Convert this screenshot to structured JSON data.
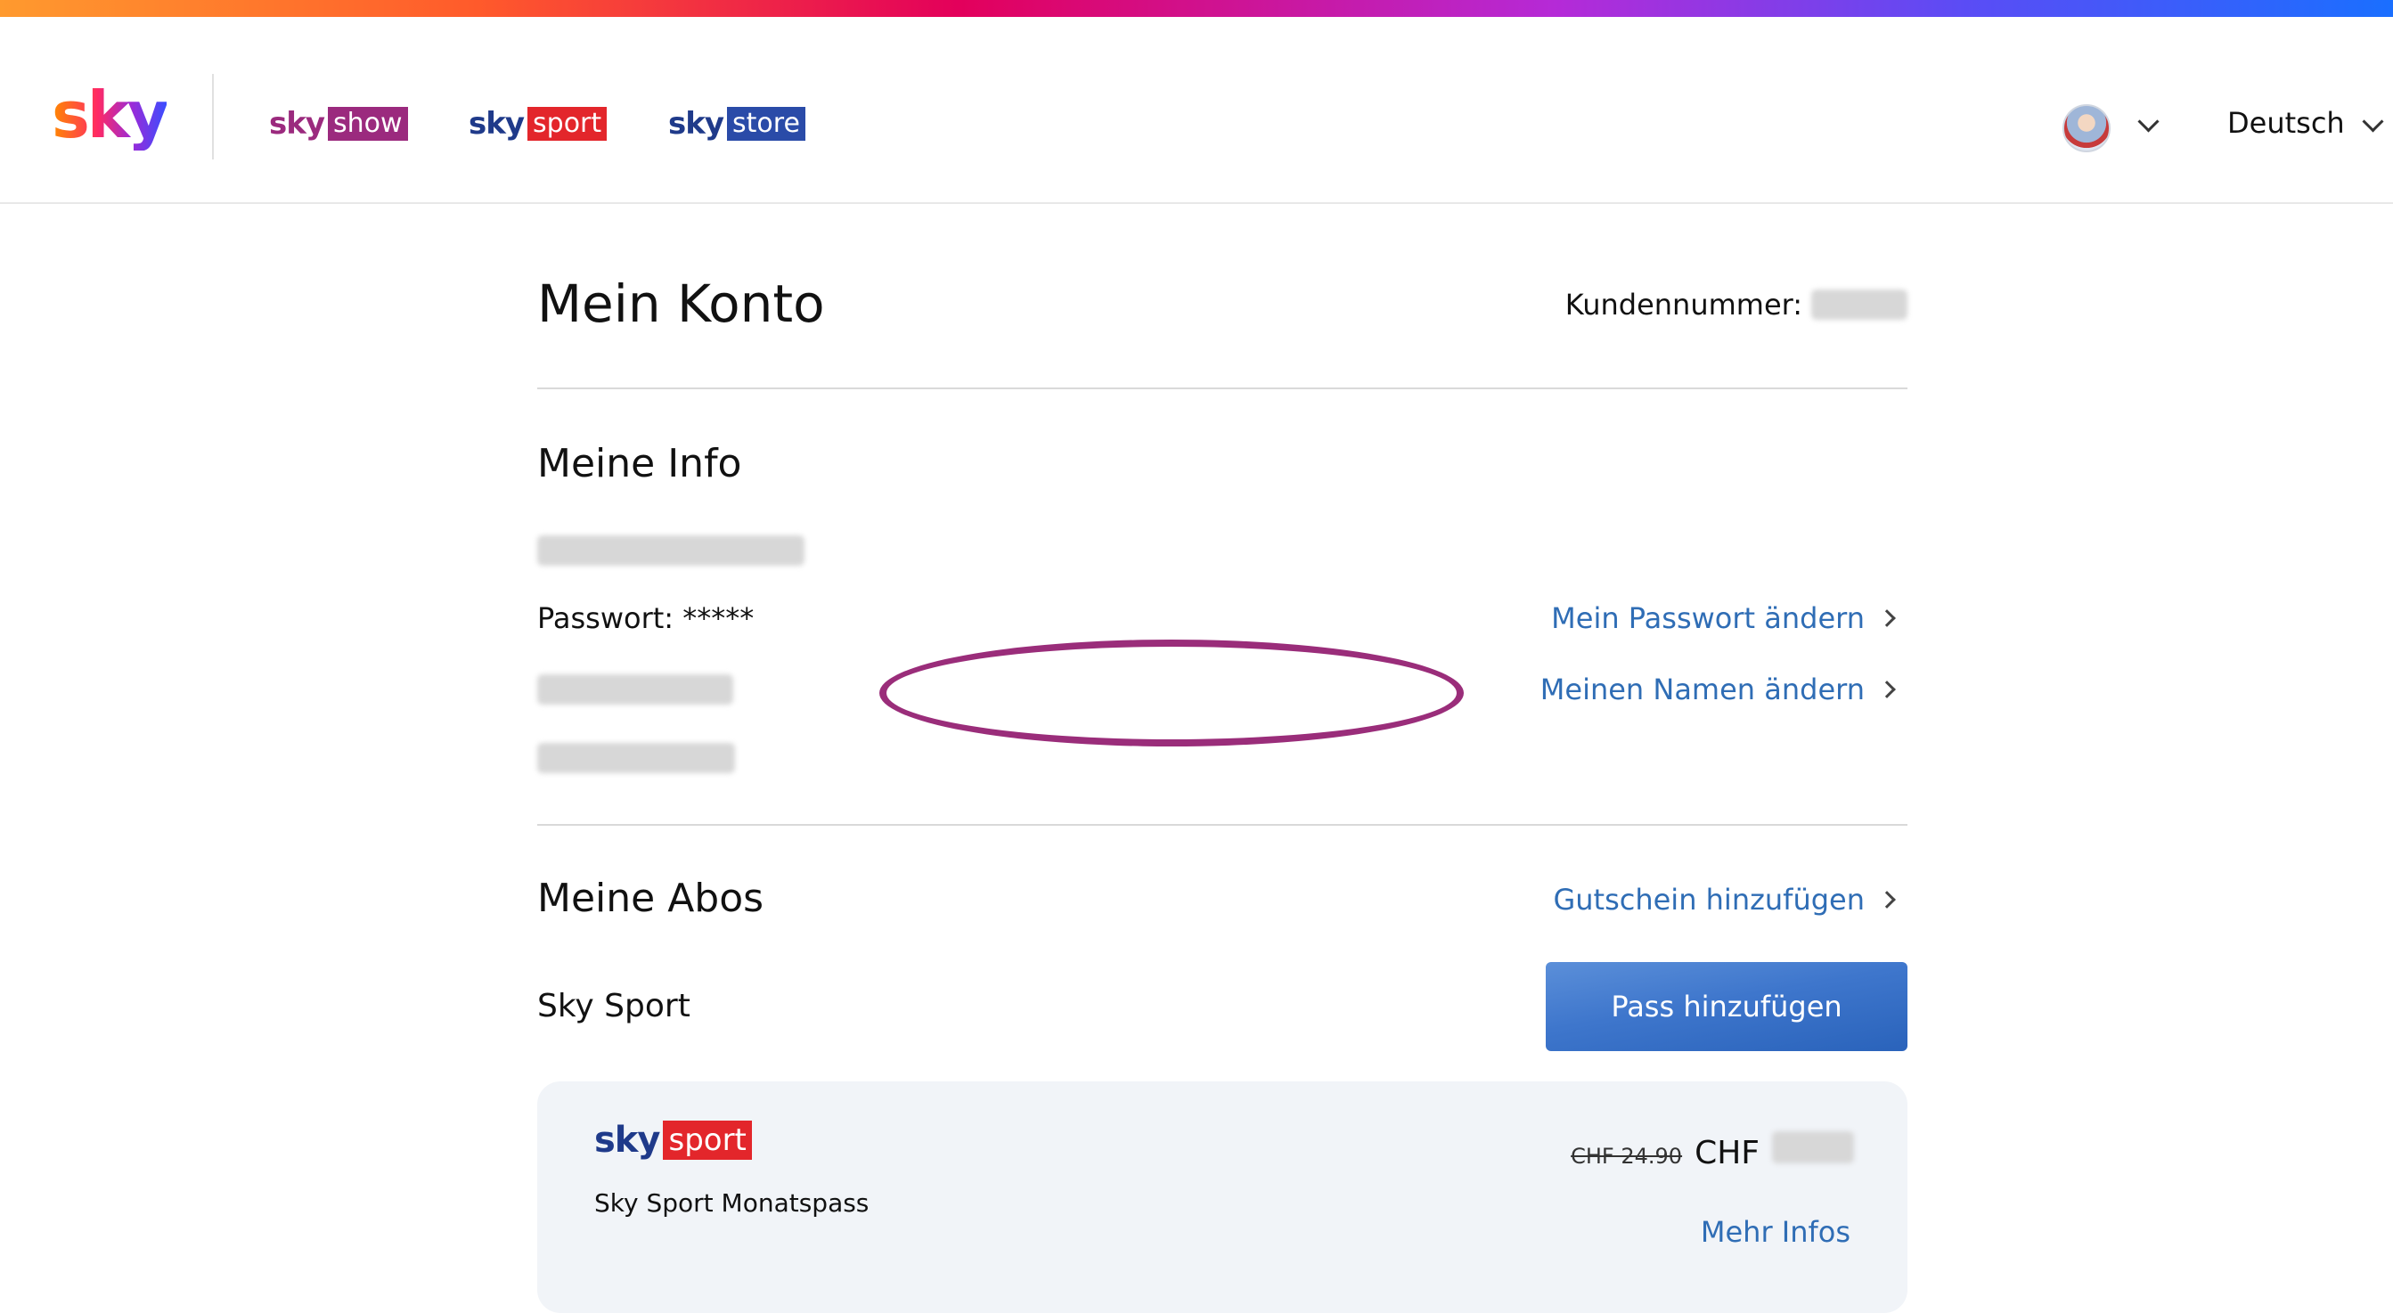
{
  "header": {
    "logo": "sky",
    "brands": [
      {
        "prefix": "sky",
        "tag": "show"
      },
      {
        "prefix": "sky",
        "tag": "sport"
      },
      {
        "prefix": "sky",
        "tag": "store"
      }
    ],
    "language": "Deutsch"
  },
  "account": {
    "title": "Mein Konto",
    "customer_number_label": "Kundennummer:"
  },
  "info": {
    "title": "Meine Info",
    "password_text": "Passwort: *****",
    "change_password": "Mein Passwort ändern",
    "change_name": "Meinen Namen ändern"
  },
  "subscriptions": {
    "title": "Meine Abos",
    "add_voucher": "Gutschein hinzufügen",
    "service": "Sky Sport",
    "add_pass": "Pass hinzufügen",
    "card": {
      "brand_prefix": "sky",
      "brand_tag": "sport",
      "product": "Sky Sport Monatspass",
      "old_price": "CHF 24.90",
      "currency": "CHF",
      "more_info": "Mehr Infos"
    }
  },
  "colors": {
    "link": "#2f6db5",
    "highlight": "#9a2d7a",
    "button": "#3e76cc"
  }
}
